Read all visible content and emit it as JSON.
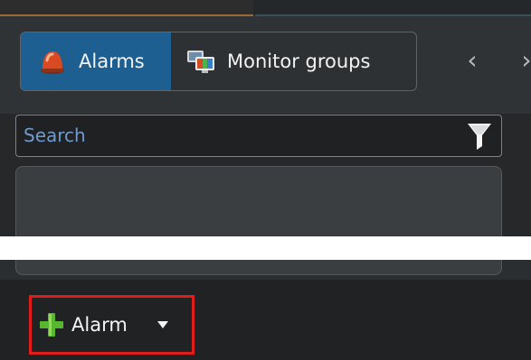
{
  "tabs": [
    {
      "label": "Alarms",
      "icon": "alarm-siren-icon",
      "active": true
    },
    {
      "label": "Monitor groups",
      "icon": "monitor-groups-icon",
      "active": false
    }
  ],
  "navigation": {
    "prev_icon": "chevron-left-icon",
    "prev_glyph": "‹",
    "next_icon": "chevron-right-icon",
    "next_glyph": "›"
  },
  "search": {
    "placeholder": "Search",
    "filter_icon": "filter-icon"
  },
  "toolbar": {
    "add_alarm_label": "Alarm",
    "add_icon": "plus-icon",
    "dropdown_icon": "caret-down-icon"
  },
  "colors": {
    "active_tab": "#1e5f91",
    "search_placeholder": "#6f9ad0",
    "highlight_border": "#e21b1b",
    "plus_green": "#56b82f",
    "alarm_red": "#d94a22"
  }
}
